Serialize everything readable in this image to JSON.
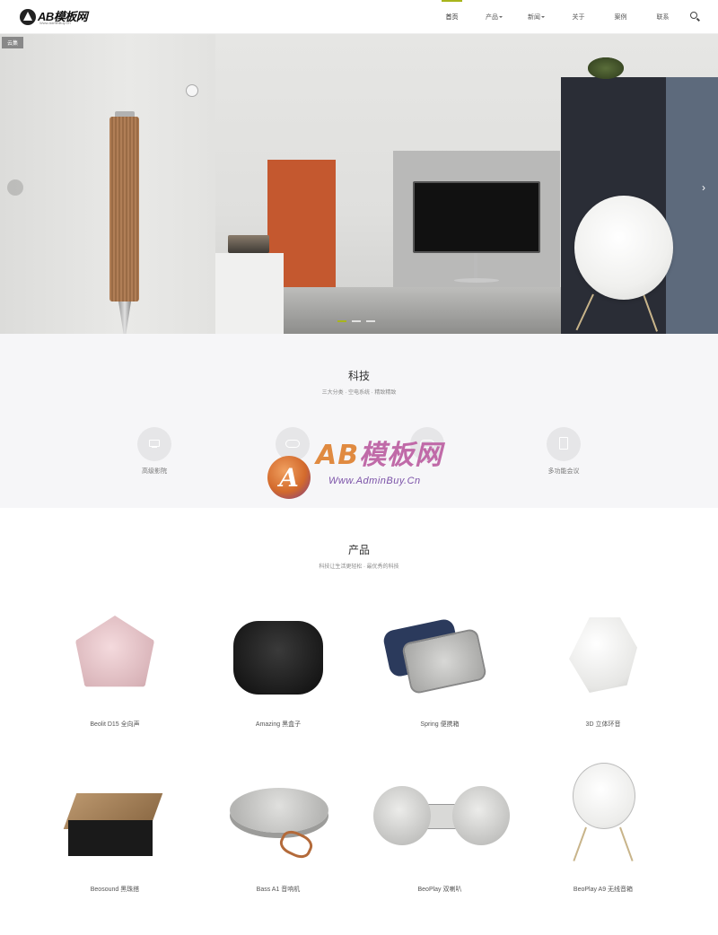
{
  "header": {
    "logo_text": "AB模板网",
    "logo_sub": "Www.AdminBuy.Cn",
    "nav": [
      {
        "label": "首页",
        "active": true,
        "dropdown": false
      },
      {
        "label": "产品",
        "active": false,
        "dropdown": true
      },
      {
        "label": "新闻",
        "active": false,
        "dropdown": true
      },
      {
        "label": "关于",
        "active": false,
        "dropdown": false
      },
      {
        "label": "案例",
        "active": false,
        "dropdown": false
      },
      {
        "label": "联系",
        "active": false,
        "dropdown": false
      }
    ],
    "search_icon": "search-icon",
    "accent_color": "#a8b51c"
  },
  "hero": {
    "tag": "云集",
    "prev_icon": "chevron-left-icon",
    "next_icon": "chevron-right-icon",
    "prev_glyph": "‹",
    "next_glyph": "›",
    "slides": 3,
    "active_slide": 1
  },
  "tech": {
    "title": "科技",
    "subtitle": "三大分类 · 空电系统 · 精致精致",
    "features": [
      {
        "icon": "monitor-icon",
        "label": "高级影院"
      },
      {
        "icon": "cloud-icon",
        "label": ""
      },
      {
        "icon": "cloud-icon",
        "label": ""
      },
      {
        "icon": "tablet-icon",
        "label": "多功能会议"
      }
    ]
  },
  "watermark": {
    "badge": "A",
    "text_a": "AB",
    "text_b": "模板网",
    "url": "Www.AdminBuy.Cn"
  },
  "products": {
    "title": "产品",
    "subtitle": "科技让生活更轻松 · 最优秀的科技",
    "items": [
      {
        "name": "Beolit D15 全向声"
      },
      {
        "name": "Amazing 黑盒子"
      },
      {
        "name": "Spring 便携箱"
      },
      {
        "name": "3D 立体环音"
      },
      {
        "name": "Beosound 黑珠搭"
      },
      {
        "name": "Bass A1 音响机"
      },
      {
        "name": "BeoPlay 双喇叭"
      },
      {
        "name": "BeoPlay A9 无线音箱"
      }
    ]
  }
}
